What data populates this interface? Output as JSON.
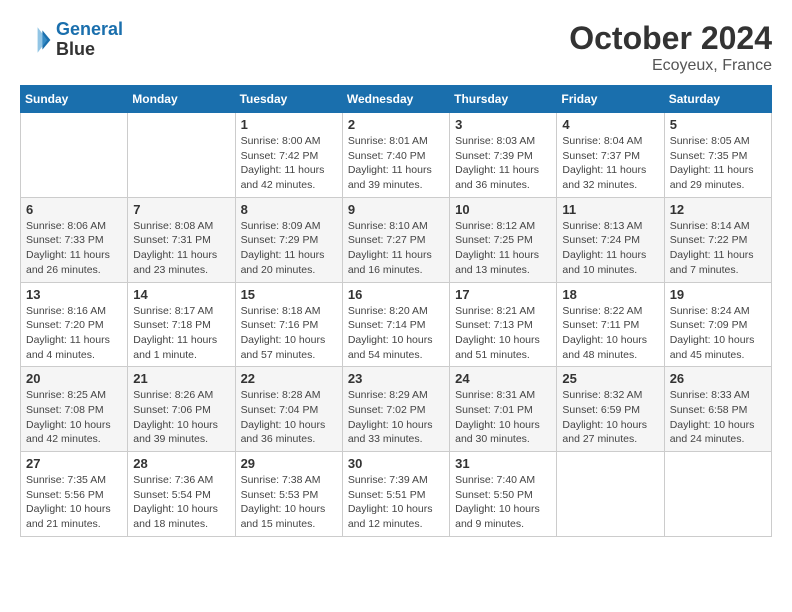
{
  "header": {
    "logo_line1": "General",
    "logo_line2": "Blue",
    "month": "October 2024",
    "location": "Ecoyeux, France"
  },
  "columns": [
    "Sunday",
    "Monday",
    "Tuesday",
    "Wednesday",
    "Thursday",
    "Friday",
    "Saturday"
  ],
  "weeks": [
    [
      {
        "day": "",
        "info": ""
      },
      {
        "day": "",
        "info": ""
      },
      {
        "day": "1",
        "info": "Sunrise: 8:00 AM\nSunset: 7:42 PM\nDaylight: 11 hours and 42 minutes."
      },
      {
        "day": "2",
        "info": "Sunrise: 8:01 AM\nSunset: 7:40 PM\nDaylight: 11 hours and 39 minutes."
      },
      {
        "day": "3",
        "info": "Sunrise: 8:03 AM\nSunset: 7:39 PM\nDaylight: 11 hours and 36 minutes."
      },
      {
        "day": "4",
        "info": "Sunrise: 8:04 AM\nSunset: 7:37 PM\nDaylight: 11 hours and 32 minutes."
      },
      {
        "day": "5",
        "info": "Sunrise: 8:05 AM\nSunset: 7:35 PM\nDaylight: 11 hours and 29 minutes."
      }
    ],
    [
      {
        "day": "6",
        "info": "Sunrise: 8:06 AM\nSunset: 7:33 PM\nDaylight: 11 hours and 26 minutes."
      },
      {
        "day": "7",
        "info": "Sunrise: 8:08 AM\nSunset: 7:31 PM\nDaylight: 11 hours and 23 minutes."
      },
      {
        "day": "8",
        "info": "Sunrise: 8:09 AM\nSunset: 7:29 PM\nDaylight: 11 hours and 20 minutes."
      },
      {
        "day": "9",
        "info": "Sunrise: 8:10 AM\nSunset: 7:27 PM\nDaylight: 11 hours and 16 minutes."
      },
      {
        "day": "10",
        "info": "Sunrise: 8:12 AM\nSunset: 7:25 PM\nDaylight: 11 hours and 13 minutes."
      },
      {
        "day": "11",
        "info": "Sunrise: 8:13 AM\nSunset: 7:24 PM\nDaylight: 11 hours and 10 minutes."
      },
      {
        "day": "12",
        "info": "Sunrise: 8:14 AM\nSunset: 7:22 PM\nDaylight: 11 hours and 7 minutes."
      }
    ],
    [
      {
        "day": "13",
        "info": "Sunrise: 8:16 AM\nSunset: 7:20 PM\nDaylight: 11 hours and 4 minutes."
      },
      {
        "day": "14",
        "info": "Sunrise: 8:17 AM\nSunset: 7:18 PM\nDaylight: 11 hours and 1 minute."
      },
      {
        "day": "15",
        "info": "Sunrise: 8:18 AM\nSunset: 7:16 PM\nDaylight: 10 hours and 57 minutes."
      },
      {
        "day": "16",
        "info": "Sunrise: 8:20 AM\nSunset: 7:14 PM\nDaylight: 10 hours and 54 minutes."
      },
      {
        "day": "17",
        "info": "Sunrise: 8:21 AM\nSunset: 7:13 PM\nDaylight: 10 hours and 51 minutes."
      },
      {
        "day": "18",
        "info": "Sunrise: 8:22 AM\nSunset: 7:11 PM\nDaylight: 10 hours and 48 minutes."
      },
      {
        "day": "19",
        "info": "Sunrise: 8:24 AM\nSunset: 7:09 PM\nDaylight: 10 hours and 45 minutes."
      }
    ],
    [
      {
        "day": "20",
        "info": "Sunrise: 8:25 AM\nSunset: 7:08 PM\nDaylight: 10 hours and 42 minutes."
      },
      {
        "day": "21",
        "info": "Sunrise: 8:26 AM\nSunset: 7:06 PM\nDaylight: 10 hours and 39 minutes."
      },
      {
        "day": "22",
        "info": "Sunrise: 8:28 AM\nSunset: 7:04 PM\nDaylight: 10 hours and 36 minutes."
      },
      {
        "day": "23",
        "info": "Sunrise: 8:29 AM\nSunset: 7:02 PM\nDaylight: 10 hours and 33 minutes."
      },
      {
        "day": "24",
        "info": "Sunrise: 8:31 AM\nSunset: 7:01 PM\nDaylight: 10 hours and 30 minutes."
      },
      {
        "day": "25",
        "info": "Sunrise: 8:32 AM\nSunset: 6:59 PM\nDaylight: 10 hours and 27 minutes."
      },
      {
        "day": "26",
        "info": "Sunrise: 8:33 AM\nSunset: 6:58 PM\nDaylight: 10 hours and 24 minutes."
      }
    ],
    [
      {
        "day": "27",
        "info": "Sunrise: 7:35 AM\nSunset: 5:56 PM\nDaylight: 10 hours and 21 minutes."
      },
      {
        "day": "28",
        "info": "Sunrise: 7:36 AM\nSunset: 5:54 PM\nDaylight: 10 hours and 18 minutes."
      },
      {
        "day": "29",
        "info": "Sunrise: 7:38 AM\nSunset: 5:53 PM\nDaylight: 10 hours and 15 minutes."
      },
      {
        "day": "30",
        "info": "Sunrise: 7:39 AM\nSunset: 5:51 PM\nDaylight: 10 hours and 12 minutes."
      },
      {
        "day": "31",
        "info": "Sunrise: 7:40 AM\nSunset: 5:50 PM\nDaylight: 10 hours and 9 minutes."
      },
      {
        "day": "",
        "info": ""
      },
      {
        "day": "",
        "info": ""
      }
    ]
  ]
}
